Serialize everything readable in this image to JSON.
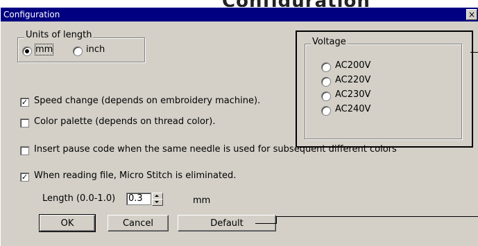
{
  "page_heading": "Configuration",
  "window": {
    "title": "Configuration",
    "close_glyph": "×"
  },
  "units": {
    "label": "Units of length",
    "options": [
      {
        "label": "mm",
        "selected": true
      },
      {
        "label": "inch",
        "selected": false
      }
    ]
  },
  "voltage": {
    "label": "Voltage",
    "options": [
      {
        "label": "AC200V",
        "selected": false
      },
      {
        "label": "AC220V",
        "selected": false
      },
      {
        "label": "AC230V",
        "selected": false
      },
      {
        "label": "AC240V",
        "selected": false
      }
    ]
  },
  "checkboxes": {
    "speed_change": {
      "label": "Speed change (depends on embroidery machine).",
      "checked": true
    },
    "color_palette": {
      "label": "Color palette (depends on thread color).",
      "checked": false
    },
    "insert_pause": {
      "label": "Insert pause code when the same needle is used for subsequent different colors",
      "checked": false
    },
    "micro_stitch": {
      "label": "When reading file, Micro Stitch is eliminated.",
      "checked": true
    }
  },
  "length": {
    "label": "Length (0.0-1.0)",
    "value": "0.3",
    "unit": "mm"
  },
  "buttons": {
    "ok": "OK",
    "cancel": "Cancel",
    "default": "Default"
  },
  "check_glyph": "✓"
}
